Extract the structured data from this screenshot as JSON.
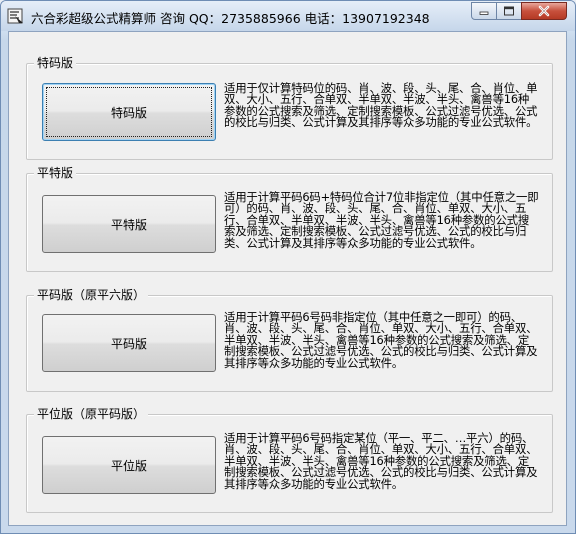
{
  "window": {
    "title": "六合彩超级公式精算师  咨询 QQ：2735885966 电话：13907192348"
  },
  "groups": [
    {
      "title": "特码版",
      "button": "特码版",
      "description": "适用于仅计算特码位的码、肖、波、段、头、尾、合、肖位、单双、大小、五行、合单双、半单双、半波、半头、禽兽等16种参数的公式搜索及筛选、定制搜索模板、公式过滤号优选、公式的校比与归类、公式计算及其排序等众多功能的专业公式软件。"
    },
    {
      "title": "平特版",
      "button": "平特版",
      "description": "适用于计算平码6码+特码位合计7位非指定位（其中任意之一即可）的码、肖、波、段、头、尾、合、肖位、单双、大小、五行、合单双、半单双、半波、半头、禽兽等16种参数的公式搜索及筛选、定制搜索模板、公式过滤号优选、公式的校比与归类、公式计算及其排序等众多功能的专业公式软件。"
    },
    {
      "title": "平码版（原平六版）",
      "button": "平码版",
      "description": "适用于计算平码6号码非指定位（其中任意之一即可）的码、肖、波、段、头、尾、合、肖位、单双、大小、五行、合单双、半单双、半波、半头、禽兽等16种参数的公式搜索及筛选、定制搜索模板、公式过滤号优选、公式的校比与归类、公式计算及其排序等众多功能的专业公式软件。"
    },
    {
      "title": "平位版（原平码版）",
      "button": "平位版",
      "description": "适用于计算平码6号码指定某位（平一、平二、…平六）的码、肖、波、段、头、尾、合、肖位、单双、大小、五行、合单双、半单双、半波、半头、禽兽等16种参数的公式搜索及筛选、定制搜索模板、公式过滤号优选、公式的校比与归类、公式计算及其排序等众多功能的专业公式软件。"
    }
  ],
  "icons": {
    "app": "app-icon",
    "minimize": "minimize-icon",
    "maximize": "maximize-icon",
    "close": "close-icon"
  }
}
